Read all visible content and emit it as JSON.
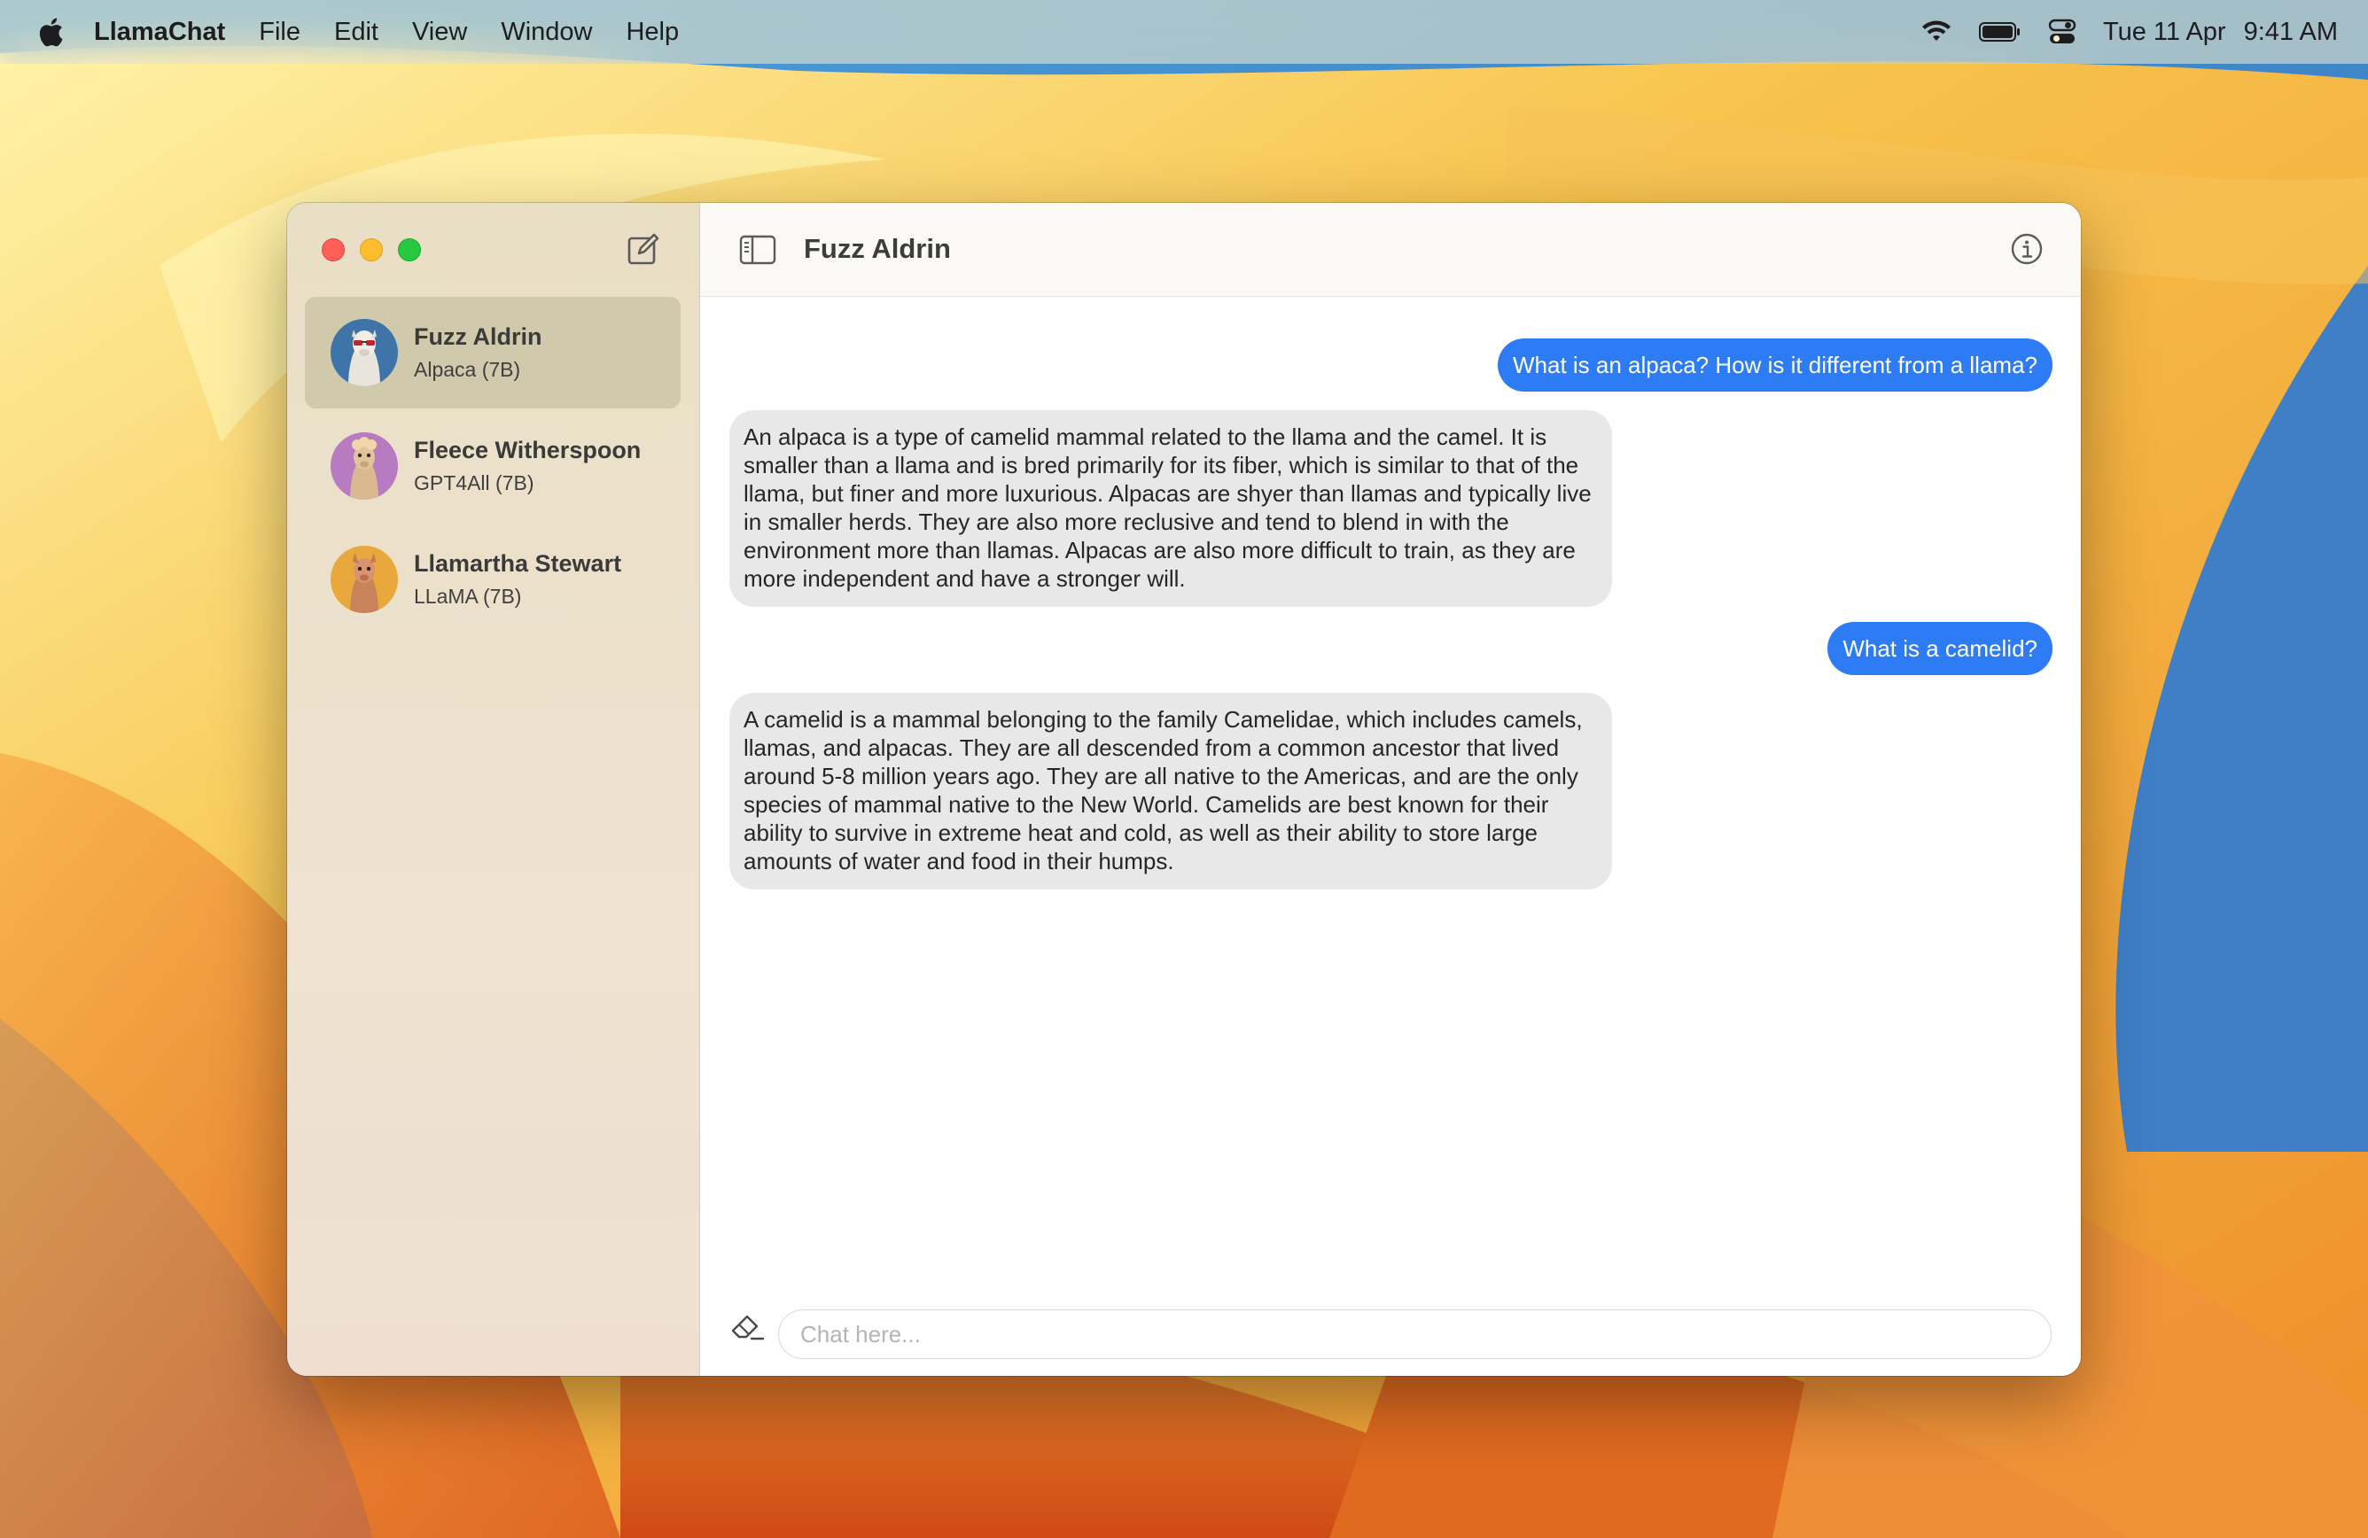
{
  "menubar": {
    "app_name": "LlamaChat",
    "menus": [
      "File",
      "Edit",
      "View",
      "Window",
      "Help"
    ],
    "date": "Tue 11 Apr",
    "time": "9:41 AM",
    "status_icons": [
      "wifi-icon",
      "battery-icon",
      "control-center-icon"
    ]
  },
  "sidebar": {
    "conversations": [
      {
        "name": "Fuzz Aldrin",
        "model": "Alpaca (7B)",
        "selected": true,
        "avatar": "llama-sunglasses-avatar"
      },
      {
        "name": "Fleece Witherspoon",
        "model": "GPT4All (7B)",
        "selected": false,
        "avatar": "llama-curly-avatar"
      },
      {
        "name": "Llamartha Stewart",
        "model": "LLaMA (7B)",
        "selected": false,
        "avatar": "llama-portrait-avatar"
      }
    ]
  },
  "chat": {
    "title": "Fuzz Aldrin",
    "messages": [
      {
        "role": "user",
        "text": "What is an alpaca? How is it different from a llama?"
      },
      {
        "role": "assistant",
        "text": "An alpaca is a type of camelid mammal related to the llama and the camel. It is smaller than a llama and is bred primarily for its fiber, which is similar to that of the llama, but finer and more luxurious. Alpacas are shyer than llamas and typically live in smaller herds. They are also more reclusive and tend to blend in with the environment more than llamas. Alpacas are also more difficult to train, as they are more independent and have a stronger will."
      },
      {
        "role": "user",
        "text": "What is a camelid?"
      },
      {
        "role": "assistant",
        "text": "A camelid is a mammal belonging to the family Camelidae, which includes camels, llamas, and alpacas. They are all descended from a common ancestor that lived around 5-8 million years ago. They are all native to the Americas, and are the only species of mammal native to the New World. Camelids are best known for their ability to survive in extreme heat and cold, as well as their ability to store large amounts of water and food in their humps."
      }
    ],
    "input_placeholder": "Chat here...",
    "input_value": ""
  },
  "colors": {
    "user_bubble": "#2d7cf6",
    "assistant_bubble": "#e8e8e8",
    "sidebar_selected": "#d1c9ab"
  }
}
